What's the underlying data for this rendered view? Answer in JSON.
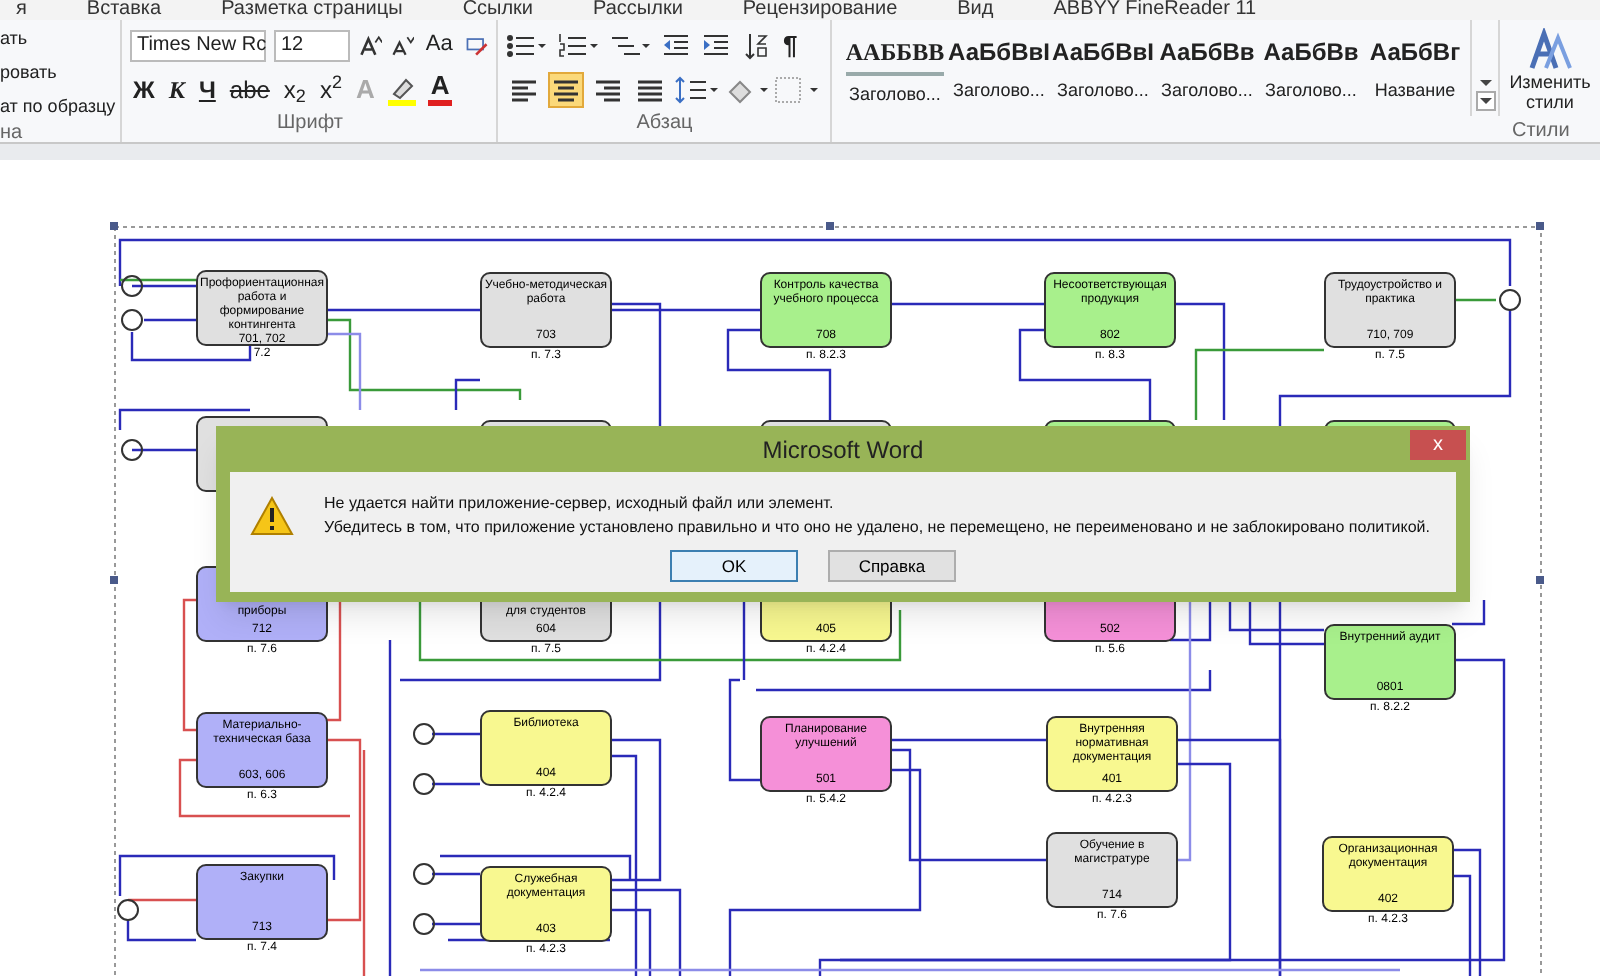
{
  "tabs": [
    "я",
    "Вставка",
    "Разметка страницы",
    "Ссылки",
    "Рассылки",
    "Рецензирование",
    "Вид",
    "ABBYY FineReader 11"
  ],
  "clipboard": {
    "items": [
      "ать",
      "ровать",
      "ат по образцу"
    ],
    "group": "на"
  },
  "font": {
    "name": "Times New Rc",
    "size": "12",
    "case_button": "Aa",
    "group": "Шрифт",
    "buttons": [
      {
        "kind": "bold",
        "text": "Ж"
      },
      {
        "kind": "italic",
        "text": "К"
      },
      {
        "kind": "underline",
        "text": "Ч"
      },
      {
        "kind": "strike",
        "text": "abe"
      },
      {
        "kind": "script",
        "text": "x$_{2}$"
      },
      {
        "kind": "script",
        "text": "x$^{2}$"
      },
      {
        "kind": "effect",
        "text": "A"
      },
      {
        "kind": "highlight"
      },
      {
        "kind": "color",
        "text": "A"
      }
    ]
  },
  "paragraph": {
    "pilcrow": "¶",
    "group": "Абзац",
    "align": [
      {
        "selected": false
      },
      {
        "selected": true
      },
      {
        "selected": false
      },
      {
        "selected": false
      }
    ]
  },
  "styles": {
    "group": "Стили",
    "change": "Изменить стили",
    "items": [
      {
        "sample": "ААББВВ",
        "label": "Заголово..."
      },
      {
        "sample": "АаБбВвI",
        "label": "Заголово..."
      },
      {
        "sample": "АаБбВвI",
        "label": "Заголово..."
      },
      {
        "sample": "АаБбВв",
        "label": "Заголово..."
      },
      {
        "sample": "АаБбВв",
        "label": "Заголово..."
      },
      {
        "sample": "АаБбВг",
        "label": "Название"
      }
    ]
  },
  "diagram": {
    "nodes": [
      {
        "label": "Профориентационная работа и формирование контингента",
        "code": "701, 702",
        "ref": "7.2",
        "color": "#e0e0e0"
      },
      {
        "label": "Учебно-методическая работа",
        "code": "703",
        "ref": "п. 7.3",
        "color": "#e0e0e0"
      },
      {
        "label": "Контроль качества учебного процесса",
        "code": "708",
        "ref": "п. 8.2.3",
        "color": "#a8f08c"
      },
      {
        "label": "Несоответствующая продукция",
        "code": "802",
        "ref": "п. 8.3",
        "color": "#a8f08c"
      },
      {
        "label": "Трудоустройство и практика",
        "code": "710, 709",
        "ref": "п. 7.5",
        "color": "#e0e0e0"
      },
      {
        "color": "#e0e0e0"
      },
      {
        "color": "#e0e0e0"
      },
      {
        "color": "#e0e0e0"
      },
      {
        "color": "#a8f08c"
      },
      {
        "color": "#a8f08c"
      },
      {
        "label": "приборы",
        "code": "712",
        "ref": "п. 7.6",
        "color": "#b0b0f8"
      },
      {
        "label": "для студентов",
        "code": "604",
        "ref": "п. 7.5",
        "color": "#e0e0e0"
      },
      {
        "code": "405",
        "ref": "п. 4.2.4",
        "color": "#f8f890"
      },
      {
        "code": "502",
        "ref": "п. 5.6",
        "color": "#f590d8"
      },
      {
        "label": "Внутренний аудит",
        "code": "0801",
        "ref": "п. 8.2.2",
        "color": "#a8f08c"
      },
      {
        "label": "Материально-техническая база",
        "code": "603, 606",
        "ref": "п. 6.3",
        "color": "#b0b0f8"
      },
      {
        "label": "Библиотека",
        "code": "404",
        "ref": "п. 4.2.4",
        "color": "#f8f890"
      },
      {
        "label": "Планирование улучшений",
        "code": "501",
        "ref": "п. 5.4.2",
        "color": "#f590d8"
      },
      {
        "label": "Внутренняя нормативная документация",
        "code": "401",
        "ref": "п. 4.2.3",
        "color": "#f8f890"
      },
      {
        "label": "Обучение в магистратуре",
        "code": "714",
        "ref": "п. 7.6",
        "color": "#e0e0e0"
      },
      {
        "label": "Организационная документация",
        "code": "402",
        "ref": "п. 4.2.3",
        "color": "#f8f890"
      },
      {
        "label": "Закупки",
        "code": "713",
        "ref": "п. 7.4",
        "color": "#b0b0f8"
      },
      {
        "label": "Служебная документация",
        "code": "403",
        "ref": "п. 4.2.3",
        "color": "#f8f890"
      }
    ]
  },
  "dialog": {
    "title": "Microsoft Word",
    "close": "x",
    "lines": [
      "Не удается найти приложение-сервер, исходный файл или элемент.",
      "Убедитесь в том, что приложение установлено правильно и что оно не удалено, не перемещено, не переименовано и не заблокировано политикой."
    ],
    "buttons": [
      {
        "label": "OK",
        "default": true
      },
      {
        "label": "Справка",
        "default": false
      }
    ]
  }
}
